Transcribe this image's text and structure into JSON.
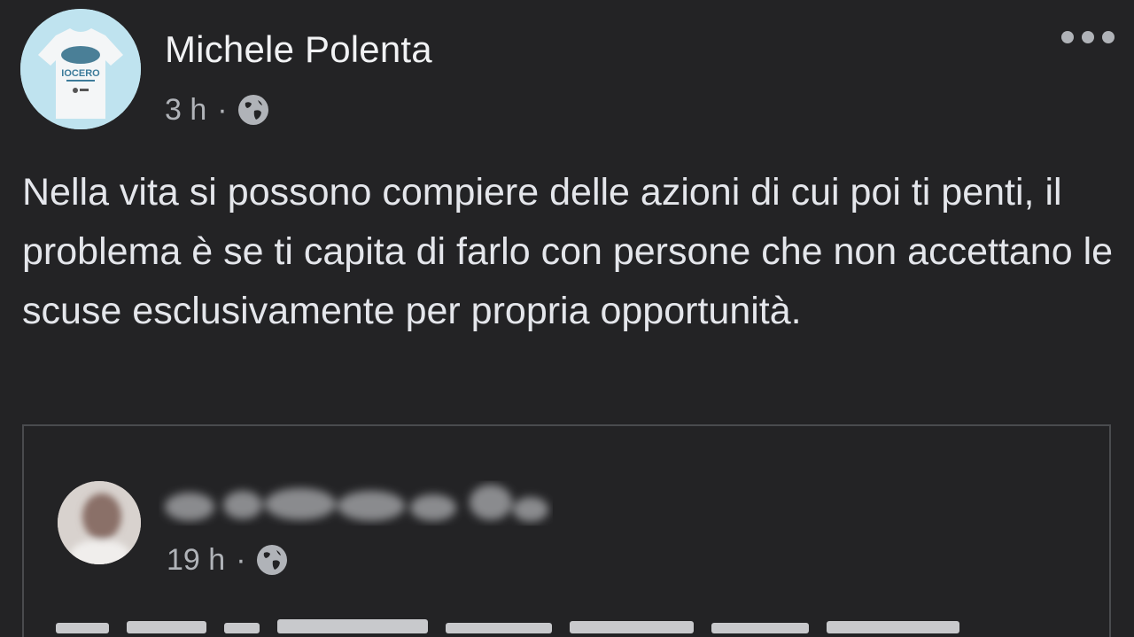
{
  "post": {
    "author": "Michele Polenta",
    "time": "3 h",
    "separator": "·",
    "privacy_icon": "globe-icon",
    "more_icon": "more-options-icon",
    "text": "Nella vita si possono compiere delle azioni di cui poi ti penti, il problema è se ti capita di farlo con persone che non accettano le scuse esclusivamente per propria opportunità.",
    "avatar_shirt_text": "IOCERO"
  },
  "shared_post": {
    "time": "19 h",
    "separator": "·",
    "privacy_icon": "globe-icon",
    "author_blurred": true
  },
  "colors": {
    "background": "#232325",
    "text": "#e4e6eb",
    "secondary": "#b0b3b8",
    "border": "#4a4b4e"
  }
}
